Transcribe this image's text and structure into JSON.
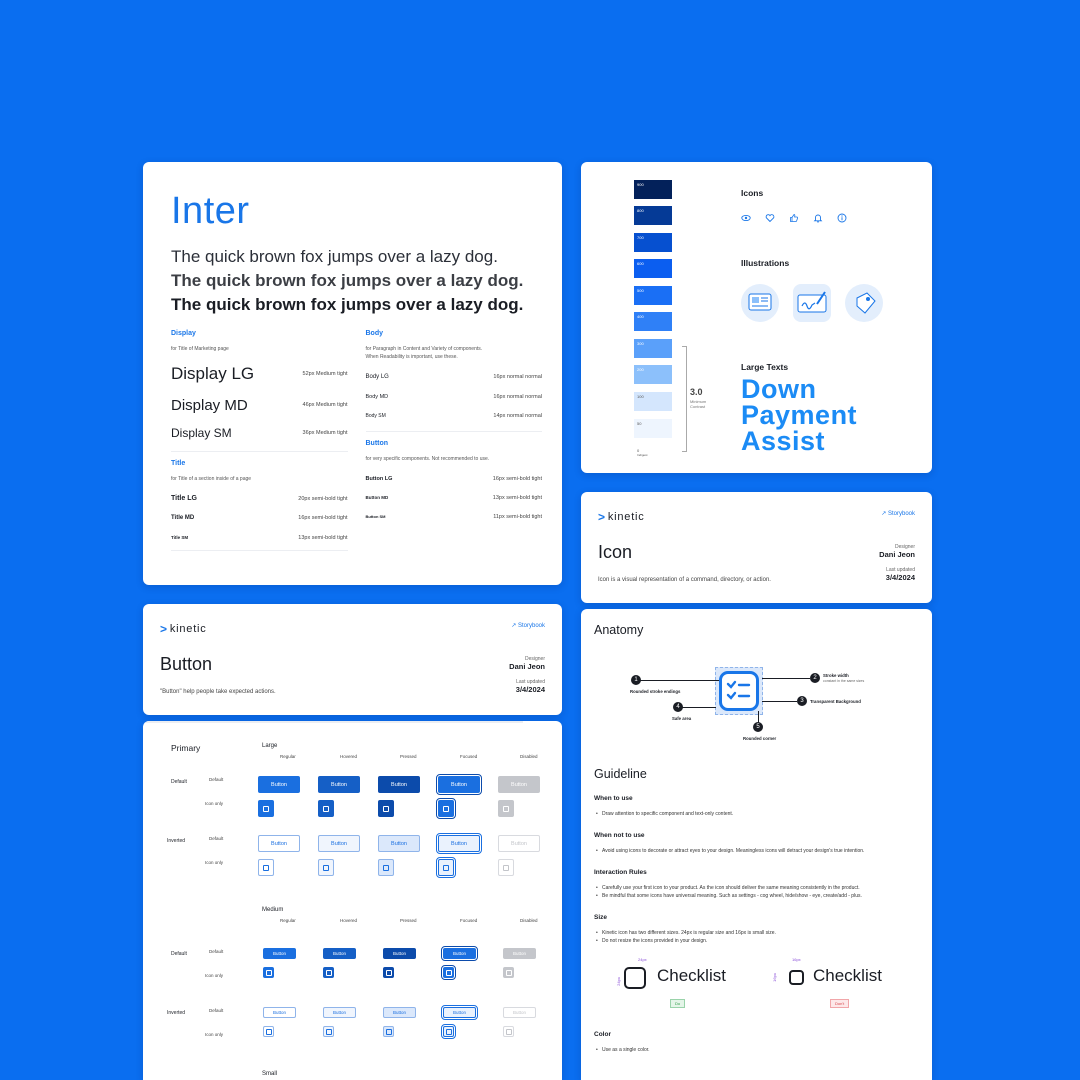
{
  "typography": {
    "font_name": "Inter",
    "pangram": "The quick brown fox jumps over a lazy dog.",
    "display": {
      "heading": "Display",
      "desc": "for Title of Marketing page",
      "rows": [
        {
          "name": "Display LG",
          "spec": "52px Medium tight"
        },
        {
          "name": "Display MD",
          "spec": "46px Medium tight"
        },
        {
          "name": "Display SM",
          "spec": "36px Medium tight"
        }
      ]
    },
    "title": {
      "heading": "Title",
      "desc": "for Title of a section inside of a page",
      "rows": [
        {
          "name": "Title LG",
          "spec": "20px semi-bold tight"
        },
        {
          "name": "Title MD",
          "spec": "16px semi-bold tight"
        },
        {
          "name": "Title SM",
          "spec": "13px semi-bold tight"
        }
      ]
    },
    "body": {
      "heading": "Body",
      "desc1": "for Paragraph in Content and Variety of components.",
      "desc2": "When Readability is important, use these.",
      "rows": [
        {
          "name": "Body LG",
          "spec": "16px normal normal"
        },
        {
          "name": "Body MD",
          "spec": "16px normal normal"
        },
        {
          "name": "Body SM",
          "spec": "14px normal normal"
        }
      ]
    },
    "button": {
      "heading": "Button",
      "desc": "for very specific components. Not recommended to use.",
      "rows": [
        {
          "name": "Button LG",
          "spec": "16px semi-bold tight"
        },
        {
          "name": "Button MD",
          "spec": "13px semi-bold tight"
        },
        {
          "name": "Button SM",
          "spec": "11px semi-bold tight"
        }
      ]
    }
  },
  "palette": {
    "swatches": [
      {
        "label": "900",
        "color": "#03215a"
      },
      {
        "label": "800",
        "color": "#053a96"
      },
      {
        "label": "700",
        "color": "#0650d0"
      },
      {
        "label": "600",
        "color": "#0b5ef0"
      },
      {
        "label": "500",
        "color": "#1a6ff5"
      },
      {
        "label": "400",
        "color": "#2f80f7"
      },
      {
        "label": "300",
        "color": "#5aa0fa"
      },
      {
        "label": "200",
        "color": "#8cc0fb"
      },
      {
        "label": "100",
        "color": "#d4e6fd"
      },
      {
        "label": "50",
        "color": "#eef5fe"
      },
      {
        "label": "0",
        "color": "#ffffff"
      }
    ],
    "swatch_zero_sub": "Indigest",
    "contrast_value": "3.0",
    "contrast_label1": "Minimum",
    "contrast_label2": "Contrast",
    "icons_heading": "Icons",
    "illustrations_heading": "Illustrations",
    "large_texts_heading": "Large Texts",
    "large_text_lines": [
      "Down",
      "Payment",
      "Assist"
    ]
  },
  "brand": {
    "name": "kinetic",
    "chevron": ">"
  },
  "icon_page": {
    "storybook": "Storybook",
    "title": "Icon",
    "description": "Icon is a visual representation of a command, directory, or action.",
    "designer_label": "Designer",
    "designer": "Dani Jeon",
    "updated_label": "Last updated",
    "updated": "3/4/2024"
  },
  "button_page": {
    "storybook": "Storybook",
    "title": "Button",
    "description": "\"Button\" help people take expected actions.",
    "designer_label": "Designer",
    "designer": "Dani Jeon",
    "updated_label": "Last updated",
    "updated": "3/4/2024"
  },
  "guide": {
    "anatomy": "Anatomy",
    "anatomy_labels": {
      "n1": "1",
      "l1": "Rounded stroke endings",
      "n2": "2",
      "l2": "Stroke width",
      "s2": "constant in the same sizes",
      "n3": "3",
      "l3": "Transparent Background",
      "n4": "4",
      "l4": "Safe area",
      "n5": "5",
      "l5": "Rounded corner"
    },
    "guideline": "Guideline",
    "when_to_use": "When to use",
    "when_to_use_items": [
      "Draw attention to specific component and text-only content."
    ],
    "when_not": "When not to use",
    "when_not_items": [
      "Avoid using icons to decorate or attract eyes to your design. Meaningless icons will detract your design's true intention."
    ],
    "interaction": "Interaction Rules",
    "interaction_items": [
      "Carefully use your first icon to your product. As the icon should deliver the same meaning consistently in the product.",
      "Be mindful that some icons have universal meaning. Such as settings - cog wheel, hide/show - eye, create/add - plus."
    ],
    "size": "Size",
    "size_items": [
      "Kinetic icon has two different sizes. 24px is regular size and 16px is small size.",
      "Do not resize the icons provided in your design."
    ],
    "size_24": "24px",
    "size_16": "16px",
    "checklist": "Checklist",
    "do_label": "Do",
    "dont_label": "Don't",
    "color": "Color",
    "color_items": [
      "Use as a single color."
    ]
  },
  "button_matrix": {
    "primary": "Primary",
    "large": "Large",
    "medium": "Medium",
    "small": "Small",
    "states": [
      "Regular",
      "Hovered",
      "Pressed",
      "Focused",
      "Disabled"
    ],
    "default": "Default",
    "inverted": "Inverted",
    "default_sub": "Default",
    "icon_only": "Icon only",
    "button_label": "Button"
  }
}
